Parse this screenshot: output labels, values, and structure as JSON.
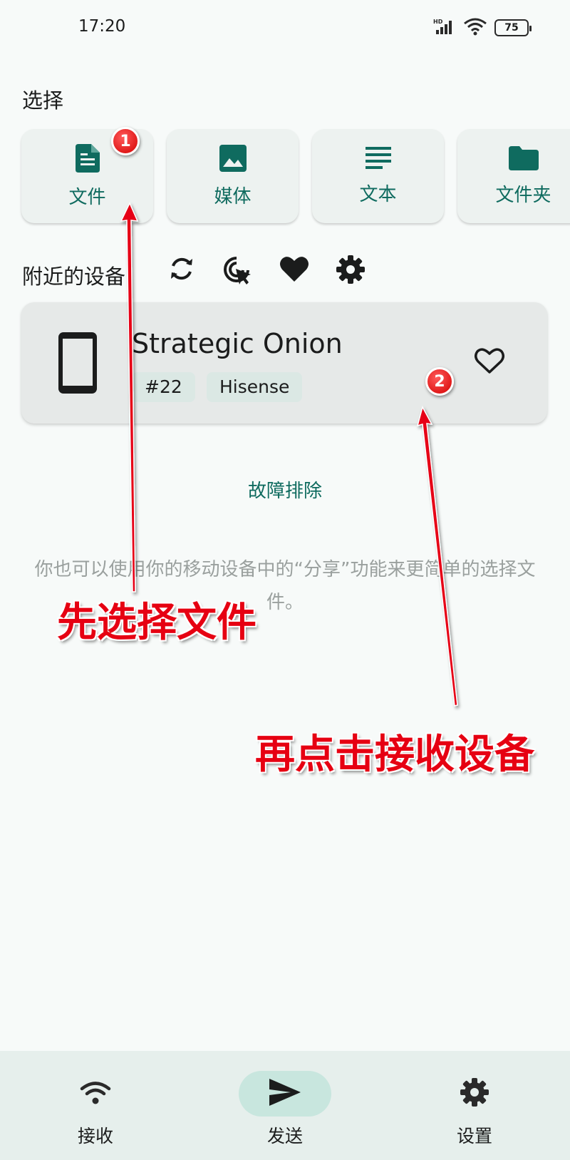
{
  "status_bar": {
    "time": "17:20",
    "network": "HD",
    "battery": "75"
  },
  "select": {
    "title": "选择",
    "items": [
      {
        "label": "文件",
        "icon": "file-icon"
      },
      {
        "label": "媒体",
        "icon": "image-icon"
      },
      {
        "label": "文本",
        "icon": "text-icon"
      },
      {
        "label": "文件夹",
        "icon": "folder-icon"
      }
    ]
  },
  "nearby": {
    "title": "附近的设备",
    "actions": [
      "refresh-icon",
      "manual-select-icon",
      "favorites-icon",
      "settings-icon"
    ],
    "device": {
      "name": "Strategic Onion",
      "tags": [
        "#22",
        "Hisense"
      ]
    }
  },
  "troubleshoot": "故障排除",
  "hint": "你也可以使用你的移动设备中的“分享”功能来更简单的选择文件。",
  "annotations": {
    "badge1": "1",
    "badge2": "2",
    "step1": "先选择文件",
    "step2": "再点击接收设备",
    "color": "#e60012"
  },
  "bottom_nav": {
    "items": [
      {
        "label": "接收",
        "icon": "wifi-icon"
      },
      {
        "label": "发送",
        "icon": "send-icon",
        "active": true
      },
      {
        "label": "设置",
        "icon": "gear-icon"
      }
    ]
  },
  "colors": {
    "accent": "#0f6b5f",
    "background": "#f7faf9",
    "nav_active": "#c8e6de"
  }
}
